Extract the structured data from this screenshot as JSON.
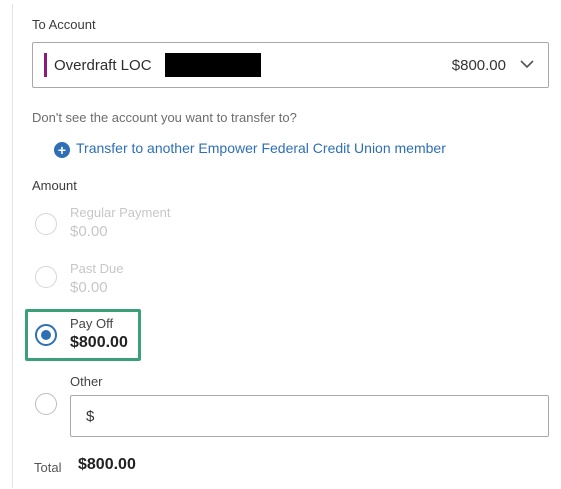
{
  "to_account": {
    "label": "To Account",
    "selected_account": "Overdraft LOC",
    "balance": "$800.00",
    "accent_color": "#8b1a7f"
  },
  "helper_text": "Don't see the account you want to transfer to?",
  "transfer_link": "Transfer to another Empower Federal Credit Union member",
  "amount": {
    "label": "Amount",
    "options": [
      {
        "title": "Regular Payment",
        "value": "$0.00",
        "selected": false,
        "disabled": true
      },
      {
        "title": "Past Due",
        "value": "$0.00",
        "selected": false,
        "disabled": true
      },
      {
        "title": "Pay Off",
        "value": "$800.00",
        "selected": true,
        "disabled": false
      },
      {
        "title": "Other",
        "value": "",
        "selected": false,
        "disabled": false
      }
    ],
    "other_input_value": "$"
  },
  "total": {
    "label": "Total",
    "value": "$800.00"
  },
  "colors": {
    "link": "#2e6fb5",
    "highlight": "#3aa07a"
  }
}
